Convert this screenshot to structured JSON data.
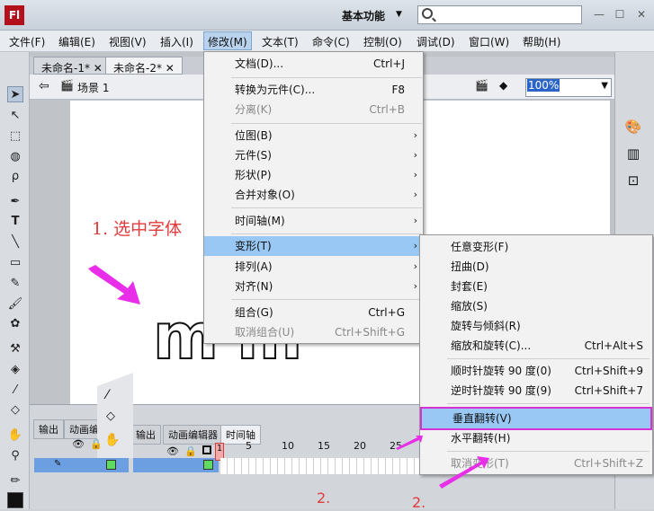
{
  "app": {
    "logo": "Fl",
    "workspace": "基本功能",
    "search_placeholder": "",
    "win_min": "—",
    "win_max": "☐",
    "win_close": "✕"
  },
  "menubar": [
    "文件(F)",
    "编辑(E)",
    "视图(V)",
    "插入(I)",
    "修改(M)",
    "文本(T)",
    "命令(C)",
    "控制(O)",
    "调试(D)",
    "窗口(W)",
    "帮助(H)"
  ],
  "tabs": [
    "未命名-1*",
    "未命名-2*"
  ],
  "scene": {
    "label": "场景 1",
    "zoom": "100%"
  },
  "annotations": {
    "step1": "1. 选中字体",
    "step2a": "2.",
    "step2b": "2."
  },
  "stage_text": "m m",
  "panels": {
    "output": "输出",
    "motion_editor": "动画编辑器",
    "timeline": "时间轴",
    "output_short": "输出",
    "motion_short": "动画编"
  },
  "frame_numbers": [
    "1",
    "5",
    "10",
    "15",
    "20",
    "25"
  ],
  "modify_menu": [
    {
      "label": "文档(D)...",
      "shortcut": "Ctrl+J"
    },
    {
      "label": "转换为元件(C)...",
      "shortcut": "F8"
    },
    {
      "label": "分离(K)",
      "shortcut": "Ctrl+B",
      "disabled": true
    },
    {
      "label": "位图(B)",
      "submenu": true
    },
    {
      "label": "元件(S)",
      "submenu": true
    },
    {
      "label": "形状(P)",
      "submenu": true
    },
    {
      "label": "合并对象(O)",
      "submenu": true
    },
    {
      "label": "时间轴(M)",
      "submenu": true
    },
    {
      "label": "变形(T)",
      "submenu": true,
      "selected": true
    },
    {
      "label": "排列(A)",
      "submenu": true
    },
    {
      "label": "对齐(N)",
      "submenu": true
    },
    {
      "label": "组合(G)",
      "shortcut": "Ctrl+G"
    },
    {
      "label": "取消组合(U)",
      "shortcut": "Ctrl+Shift+G",
      "disabled": true
    }
  ],
  "transform_menu": [
    {
      "label": "任意变形(F)"
    },
    {
      "label": "扭曲(D)"
    },
    {
      "label": "封套(E)"
    },
    {
      "label": "缩放(S)"
    },
    {
      "label": "旋转与倾斜(R)"
    },
    {
      "label": "缩放和旋转(C)...",
      "shortcut": "Ctrl+Alt+S"
    },
    {
      "label": "顺时针旋转 90 度(0)",
      "shortcut": "Ctrl+Shift+9"
    },
    {
      "label": "逆时针旋转 90 度(9)",
      "shortcut": "Ctrl+Shift+7"
    },
    {
      "label": "垂直翻转(V)",
      "selected": true
    },
    {
      "label": "水平翻转(H)"
    },
    {
      "label": "取消变形(T)",
      "shortcut": "Ctrl+Shift+Z",
      "disabled": true
    }
  ],
  "colors": {
    "highlight": "#98c8f3",
    "annotation": "#e92ee9",
    "annotation_text": "#e03c3c"
  }
}
